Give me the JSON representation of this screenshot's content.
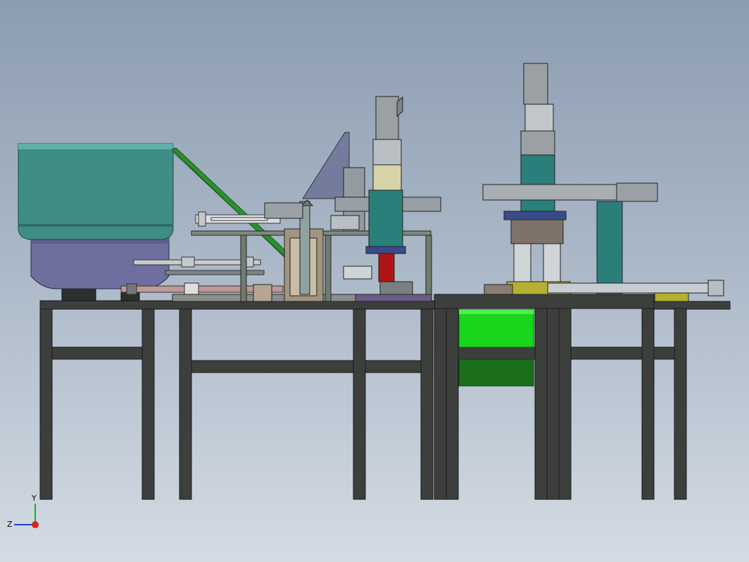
{
  "triad": {
    "y_label": "Y",
    "z_label": "Z",
    "x_color": "#e02020",
    "y_color": "#20b020",
    "z_color": "#2040d0"
  },
  "colors": {
    "frame": "#3c3f3c",
    "frame_edge": "#1a1a1a",
    "bowl_top": "#3f8e86",
    "bowl_bottom": "#6e6f9e",
    "feeder_rail": "#2f8f2f",
    "teal_block": "#2b7f7b",
    "bin": "#19d61c",
    "bin_shadow": "#1c6e1c",
    "plate": "#7e8782",
    "olive_plate": "#b5b02f",
    "motor": "#9aa0a4",
    "red_part": "#b01515",
    "bracket": "#6f6a98"
  }
}
